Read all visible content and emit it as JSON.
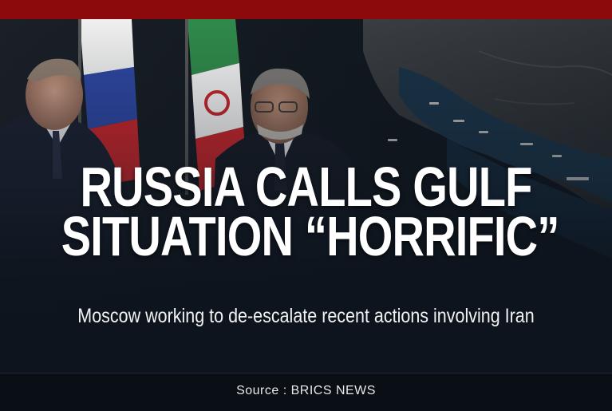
{
  "headline": {
    "line1": "RUSSIA CALLS GULF",
    "line2": "SITUATION “HORRIFIC”"
  },
  "subheadline": "Moscow working to de-escalate recent actions involving Iran",
  "footer": {
    "source": "Source : BRICS NEWS"
  },
  "colors": {
    "top_bar": "#8c0a0c",
    "background": "#0d141d",
    "text": "#ffffff",
    "sea": "#1a3347"
  }
}
